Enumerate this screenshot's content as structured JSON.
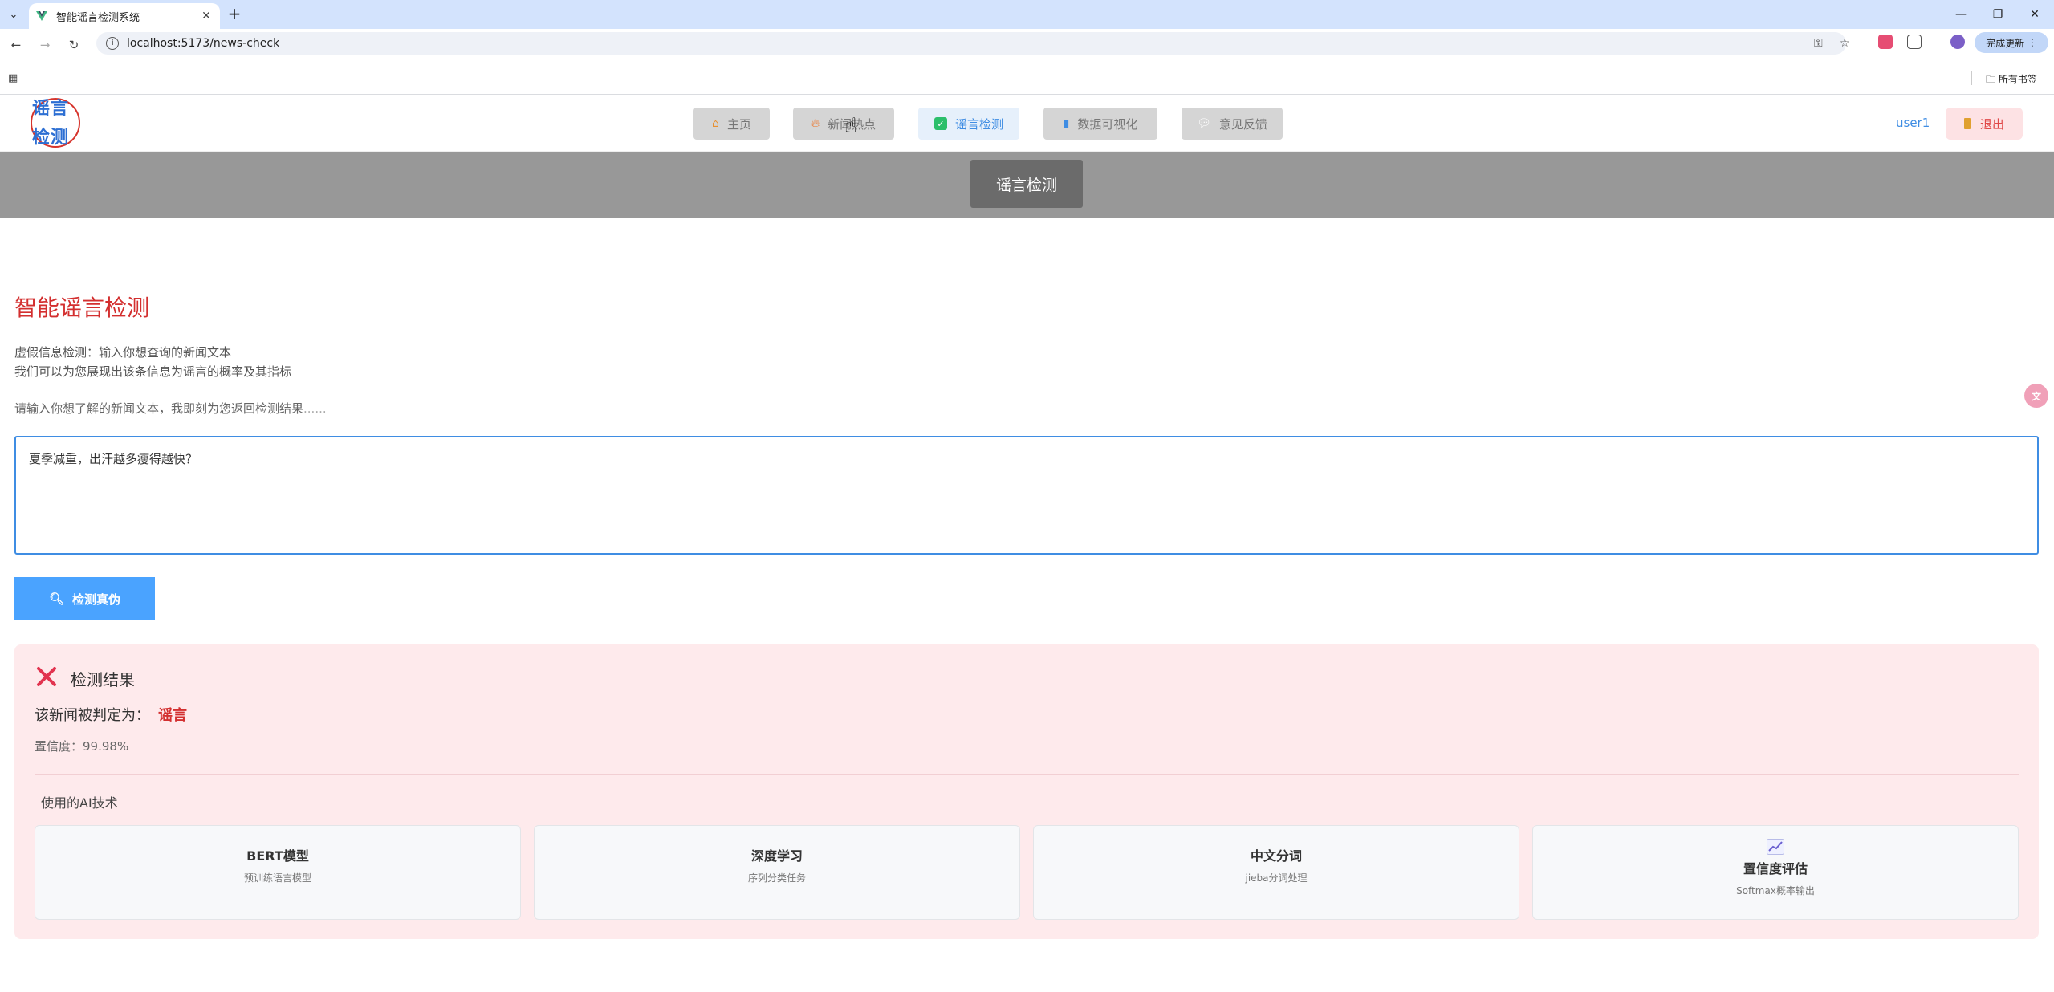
{
  "browser": {
    "tab_title": "智能谣言检测系统",
    "url": "localhost:5173/news-check",
    "update_label": "完成更新",
    "bookmarks_label": "所有书签"
  },
  "header": {
    "logo_line1": "谣言",
    "logo_line2": "检测",
    "nav": [
      {
        "label": "主页",
        "icon": "home-icon"
      },
      {
        "label": "新闻热点",
        "icon": "fire-icon"
      },
      {
        "label": "谣言检测",
        "icon": "check-icon"
      },
      {
        "label": "数据可视化",
        "icon": "bar-chart-icon"
      },
      {
        "label": "意见反馈",
        "icon": "chat-icon"
      }
    ],
    "active_nav": "谣言检测",
    "username": "user1",
    "logout_label": "退出"
  },
  "banner": {
    "label": "谣言检测"
  },
  "main": {
    "title": "智能谣言检测",
    "desc_line1": "虚假信息检测：输入你想查询的新闻文本",
    "desc_line2": "我们可以为您展现出该条信息为谣言的概率及其指标",
    "hint": "请输入你想了解的新闻文本，我即刻为您返回检测结果",
    "hint_dots": "......",
    "input_value": "夏季减重，出汗越多瘦得越快？",
    "check_button": "检测真伪"
  },
  "result": {
    "title": "检测结果",
    "verdict_label": "该新闻被判定为：",
    "verdict_value": "谣言",
    "confidence": "置信度：99.98%",
    "tech_title": "使用的AI技术",
    "tech": [
      {
        "name": "BERT模型",
        "sub": "预训练语言模型"
      },
      {
        "name": "深度学习",
        "sub": "序列分类任务"
      },
      {
        "name": "中文分词",
        "sub": "jieba分词处理"
      },
      {
        "name": "置信度评估",
        "sub": "Softmax概率输出"
      }
    ]
  },
  "colors": {
    "accent": "#3f8de3",
    "danger": "#d32f2f",
    "button": "#4aa3ff",
    "result_bg": "#feeaec"
  }
}
